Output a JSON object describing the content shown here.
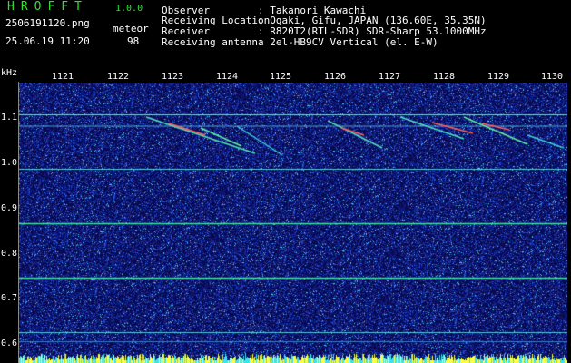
{
  "header": {
    "app_title": "HROFFT",
    "app_version": "1.0.0",
    "filename": "2506191120.png",
    "datetime": "25.06.19 11:20",
    "meteor_label": "meteor",
    "meteor_count": "98"
  },
  "station_info": [
    {
      "label": "Observer",
      "value": ": Takanori Kawachi"
    },
    {
      "label": "Receiving Location",
      "value": ": Ogaki, Gifu, JAPAN (136.60E, 35.35N)"
    },
    {
      "label": "Receiver",
      "value": ": R820T2(RTL-SDR) SDR-Sharp 53.1000MHz"
    },
    {
      "label": "Receiving antenna",
      "value": ": 2el-HB9CV Vertical (el. E-W)"
    }
  ],
  "spectrogram": {
    "y_unit": "kHz",
    "x_ticks": [
      "1121",
      "1122",
      "1123",
      "1124",
      "1125",
      "1126",
      "1127",
      "1128",
      "1129",
      "1130"
    ],
    "y_ticks": [
      "1.1",
      "1.0",
      "0.9",
      "0.8",
      "0.7",
      "0.6"
    ],
    "y_range": [
      0.58,
      1.2
    ],
    "colors": {
      "background": "#0a0a5a",
      "noise": "#2a4ad8",
      "signal": "#3fe0a0",
      "peak": "#ff6060",
      "bottom_band": "#ffff40"
    }
  }
}
